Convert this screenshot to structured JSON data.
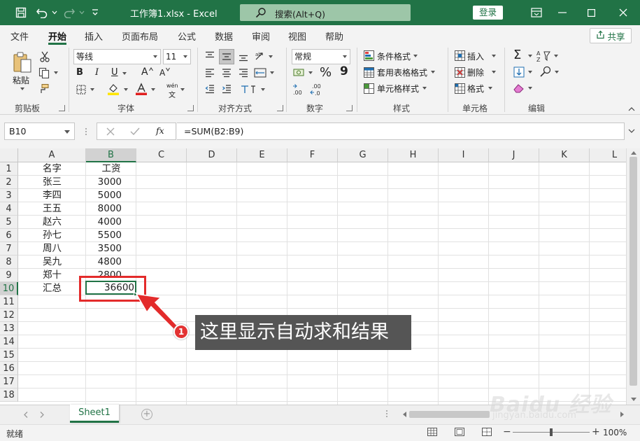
{
  "window": {
    "title": "工作簿1.xlsx  -  Excel",
    "search_placeholder": "搜索(Alt+Q)",
    "login_label": "登录"
  },
  "menu": {
    "tabs": [
      "文件",
      "开始",
      "插入",
      "页面布局",
      "公式",
      "数据",
      "审阅",
      "视图",
      "帮助"
    ],
    "active_tab": "开始",
    "share_label": "共享"
  },
  "ribbon": {
    "clipboard": {
      "label": "剪贴板",
      "paste": "粘贴"
    },
    "font": {
      "label": "字体",
      "font_name": "等线",
      "font_size": "11",
      "bold": "B",
      "italic": "I",
      "underline": "U",
      "grow": "A",
      "shrink": "A",
      "phonetic": "wén"
    },
    "alignment": {
      "label": "对齐方式"
    },
    "number": {
      "label": "数字",
      "format": "常规",
      "percent": "%",
      "comma": "9"
    },
    "styles": {
      "label": "样式",
      "conditional": "条件格式",
      "table": "套用表格格式",
      "cell_styles": "单元格样式"
    },
    "cells": {
      "label": "单元格",
      "insert": "插入",
      "delete": "删除",
      "format": "格式"
    },
    "editing": {
      "label": "编辑"
    }
  },
  "formula_bar": {
    "name_box": "B10",
    "fx": "fx",
    "formula": "=SUM(B2:B9)"
  },
  "grid": {
    "columns": [
      "A",
      "B",
      "C",
      "D",
      "E",
      "F",
      "G",
      "H",
      "I",
      "J",
      "K",
      "L"
    ],
    "rows": [
      "1",
      "2",
      "3",
      "4",
      "5",
      "6",
      "7",
      "8",
      "9",
      "10",
      "11",
      "12",
      "13",
      "14",
      "15",
      "16",
      "17",
      "18"
    ],
    "data": [
      {
        "name": "名字",
        "value": "工资"
      },
      {
        "name": "张三",
        "value": "3000"
      },
      {
        "name": "李四",
        "value": "5000"
      },
      {
        "name": "王五",
        "value": "8000"
      },
      {
        "name": "赵六",
        "value": "4000"
      },
      {
        "name": "孙七",
        "value": "5500"
      },
      {
        "name": "周八",
        "value": "3500"
      },
      {
        "name": "吴九",
        "value": "4800"
      },
      {
        "name": "郑十",
        "value": "2800"
      }
    ],
    "total_label": "汇总",
    "total_value": "36600"
  },
  "sheet_tabs": {
    "active": "Sheet1",
    "add": "+"
  },
  "status": {
    "text": "就绪",
    "zoom": "100%",
    "zoom_minus": "−",
    "zoom_plus": "+"
  },
  "annotation": {
    "badge": "1",
    "text": "这里显示自动求和结果"
  },
  "watermark": {
    "logo": "Baidu 经验",
    "url": "jingyan.baidu.com"
  },
  "colors": {
    "accent": "#217346",
    "annotation_red": "#e32b2b",
    "callout_bg": "#555555"
  }
}
